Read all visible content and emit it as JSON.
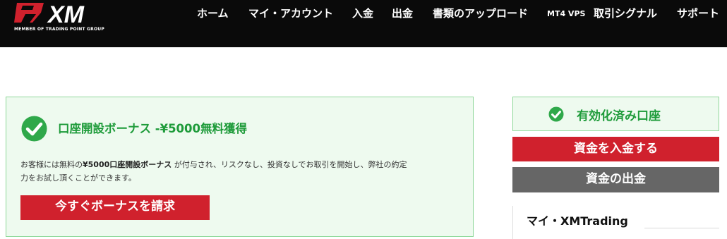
{
  "header": {
    "logo_alt": "XM",
    "logo_text": "XM",
    "logo_tagline": "MEMBER OF TRADING POINT GROUP",
    "nav": [
      {
        "label": "ホーム"
      },
      {
        "label": "マイ・アカウント"
      },
      {
        "label": "入金"
      },
      {
        "label": "出金"
      },
      {
        "label": "書類のアップロード"
      },
      {
        "label": "MT4 VPS"
      },
      {
        "label": "取引シグナル"
      },
      {
        "label": "サポート"
      }
    ]
  },
  "bonus": {
    "title": "口座開設ボーナス -¥5000無料獲得",
    "desc_prefix": "お客様には無料の",
    "desc_bold": "¥5000口座開設ボーナス",
    "desc_suffix": " が付与され、リスクなし、投資なしでお取引を開始し、弊社の約定",
    "desc_line2": "力をお試し頂くことができます。",
    "button_label": "今すぐボーナスを請求"
  },
  "sidebar": {
    "verified_label": "有効化済み口座",
    "deposit_label": "資金を入金する",
    "withdraw_label": "資金の出金",
    "account_title": "マイ・XMTrading"
  },
  "colors": {
    "brand_red": "#d0212d",
    "success_green": "#1e9b3a",
    "panel_green_bg": "#eefaef",
    "header_black": "#0a0a0a",
    "button_gray": "#666666"
  }
}
